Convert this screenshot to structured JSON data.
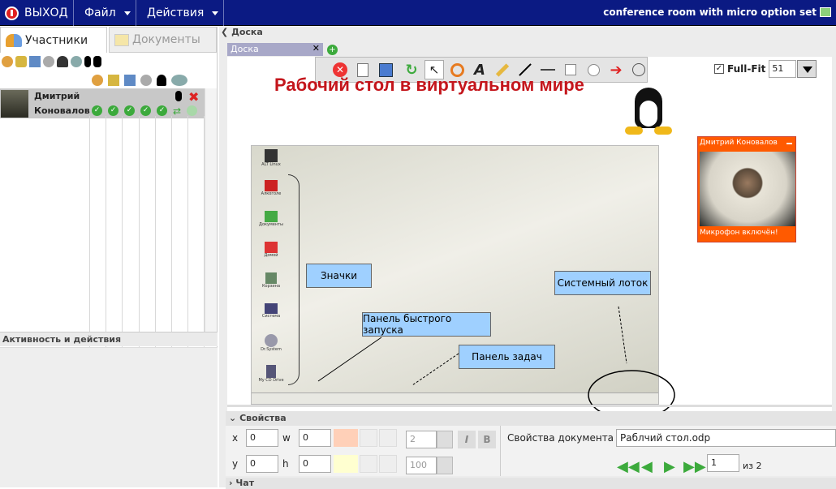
{
  "topbar": {
    "exit_label": "ВЫХОД",
    "file_label": "Файл",
    "actions_label": "Действия",
    "room_title": "conference room with micro option set"
  },
  "left": {
    "tab_participants": "Участники",
    "tab_documents": "Документы",
    "participant": {
      "first_name": "Дмитрий",
      "last_name": "Коновалов *"
    },
    "activity_title": "Активность и действия"
  },
  "board": {
    "section_title": "Доска",
    "tab_label": "Доска",
    "fullfit_label": "Full-Fit",
    "zoom_value": "51",
    "slide_title": "Рабочий стол в виртуальном мире",
    "callouts": {
      "icons": "Значки",
      "quick_launch": "Панель быстрого запуска",
      "taskbar": "Панель задач",
      "tray": "Системный лоток"
    },
    "desktop_icons": [
      "ALT Linux",
      "Алкоголе",
      "Документы",
      "Домой",
      "Корзина",
      "Система",
      "Dr.System",
      "My CD Drive"
    ],
    "video": {
      "name": "Дмитрий Коновалов",
      "mic_status": "Микрофон включён!"
    }
  },
  "properties": {
    "title": "Свойства",
    "x_label": "x",
    "x_value": "0",
    "y_label": "y",
    "y_value": "0",
    "w_label": "w",
    "w_value": "0",
    "h_label": "h",
    "h_value": "0",
    "line_width": "2",
    "opacity": "100",
    "doc_props_label": "Свойства документа",
    "doc_name": "Раблчий стол.odp",
    "page_value": "1",
    "page_of": "из  2"
  },
  "chat": {
    "title": "Чат"
  },
  "colors": {
    "topbar": "#0b1a83",
    "accent_orange": "#ff5a00",
    "callout": "#9fd0ff"
  }
}
